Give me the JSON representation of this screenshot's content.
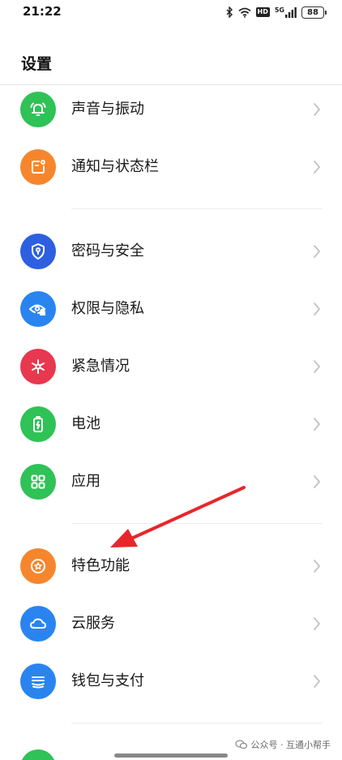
{
  "status_bar": {
    "time": "21:22",
    "hd": "HD",
    "network": "5G",
    "battery": "88"
  },
  "page": {
    "title": "设置"
  },
  "items": [
    {
      "label": "声音与振动",
      "color": "#2fc256",
      "icon": "bell-icon"
    },
    {
      "label": "通知与状态栏",
      "color": "#f5862e",
      "icon": "notification-icon"
    },
    {
      "label": "密码与安全",
      "color": "#2d5fe0",
      "icon": "shield-icon"
    },
    {
      "label": "权限与隐私",
      "color": "#2a84f0",
      "icon": "eye-lock-icon"
    },
    {
      "label": "紧急情况",
      "color": "#e8384f",
      "icon": "asterisk-icon"
    },
    {
      "label": "电池",
      "color": "#2fc256",
      "icon": "battery-icon"
    },
    {
      "label": "应用",
      "color": "#2fc256",
      "icon": "apps-grid-icon"
    },
    {
      "label": "特色功能",
      "color": "#f5862e",
      "icon": "star-badge-icon"
    },
    {
      "label": "云服务",
      "color": "#2a84f0",
      "icon": "cloud-icon"
    },
    {
      "label": "钱包与支付",
      "color": "#2a84f0",
      "icon": "wallet-icon"
    }
  ],
  "watermark": {
    "text": "公众号 · 互通小帮手"
  },
  "annotation": {
    "arrow_color": "#e8262b"
  }
}
